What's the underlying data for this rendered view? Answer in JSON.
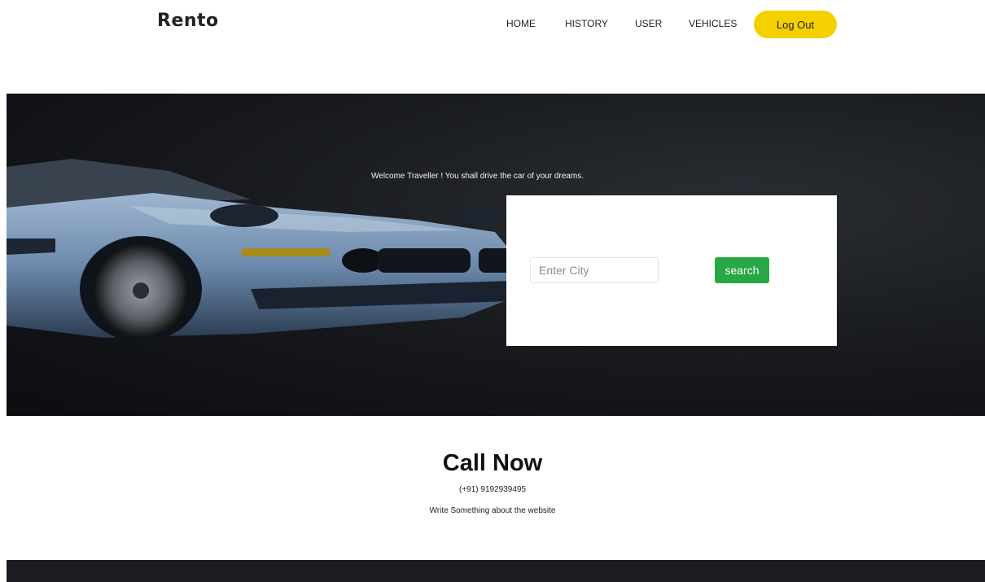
{
  "header": {
    "logo": "Rento",
    "nav": {
      "home": "HOME",
      "history": "HISTORY",
      "user": "USER",
      "vehicles": "VEHICLES"
    },
    "logout_label": "Log Out"
  },
  "hero": {
    "welcome": "Welcome Traveller ! You shall drive the car of your dreams.",
    "search": {
      "placeholder": "Enter City",
      "button_label": "search"
    }
  },
  "call": {
    "title": "Call Now",
    "phone": "(+91) 9192939495",
    "description": "Write Something about the website"
  },
  "colors": {
    "accent_yellow": "#f5d000",
    "search_green": "#28a745",
    "hero_dark": "#16181c"
  }
}
